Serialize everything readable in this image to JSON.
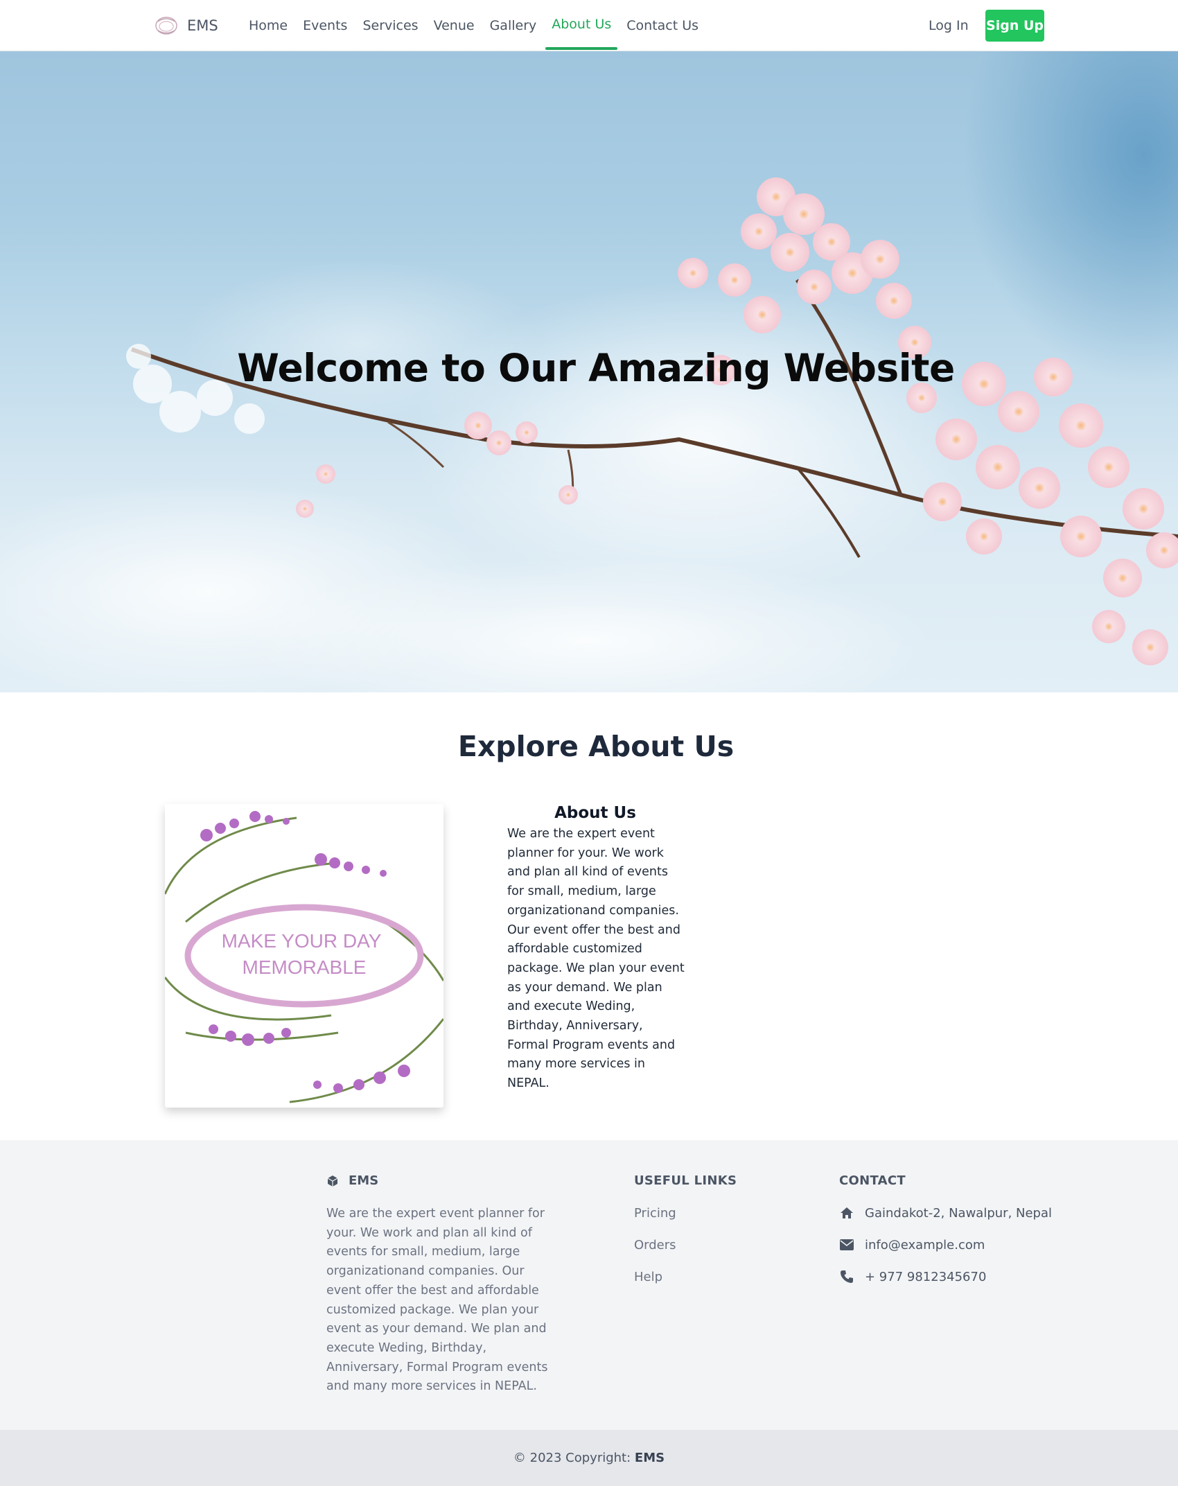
{
  "nav": {
    "brand": "EMS",
    "links": [
      "Home",
      "Events",
      "Services",
      "Venue",
      "Gallery",
      "About Us",
      "Contact Us"
    ],
    "active": "About Us",
    "login": "Log In",
    "signup": "Sign Up"
  },
  "hero": {
    "title": "Welcome to Our Amazing Website"
  },
  "about": {
    "section_title": "Explore About Us",
    "image_text_line1": "MAKE YOUR DAY",
    "image_text_line2": "MEMORABLE",
    "heading": "About Us",
    "body": "We are the expert event planner for your. We work and plan all kind of events for small, medium, large organizationand companies. Our event offer the best and affordable customized package. We plan your event as your demand. We plan and execute Weding, Birthday, Anniversary, Formal Program events and many more services in NEPAL."
  },
  "footer": {
    "brand": "EMS",
    "description": "We are the expert event planner for your. We work and plan all kind of events for small, medium, large organizationand companies. Our event offer the best and affordable customized package. We plan your event as your demand. We plan and execute Weding, Birthday, Anniversary, Formal Program events and many more services in NEPAL.",
    "links_heading": "USEFUL LINKS",
    "links": [
      "Pricing",
      "Orders",
      "Help"
    ],
    "contact_heading": "CONTACT",
    "address": "Gaindakot-2, Nawalpur, Nepal",
    "email": "info@example.com",
    "phone": "+ 977 9812345670",
    "copyright_prefix": "© 2023 Copyright: ",
    "copyright_brand": "EMS"
  },
  "colors": {
    "accent": "#22c55e",
    "accent_text": "#22a65a",
    "sky": "#a9cde3",
    "blossom": "#f6d4dc"
  }
}
